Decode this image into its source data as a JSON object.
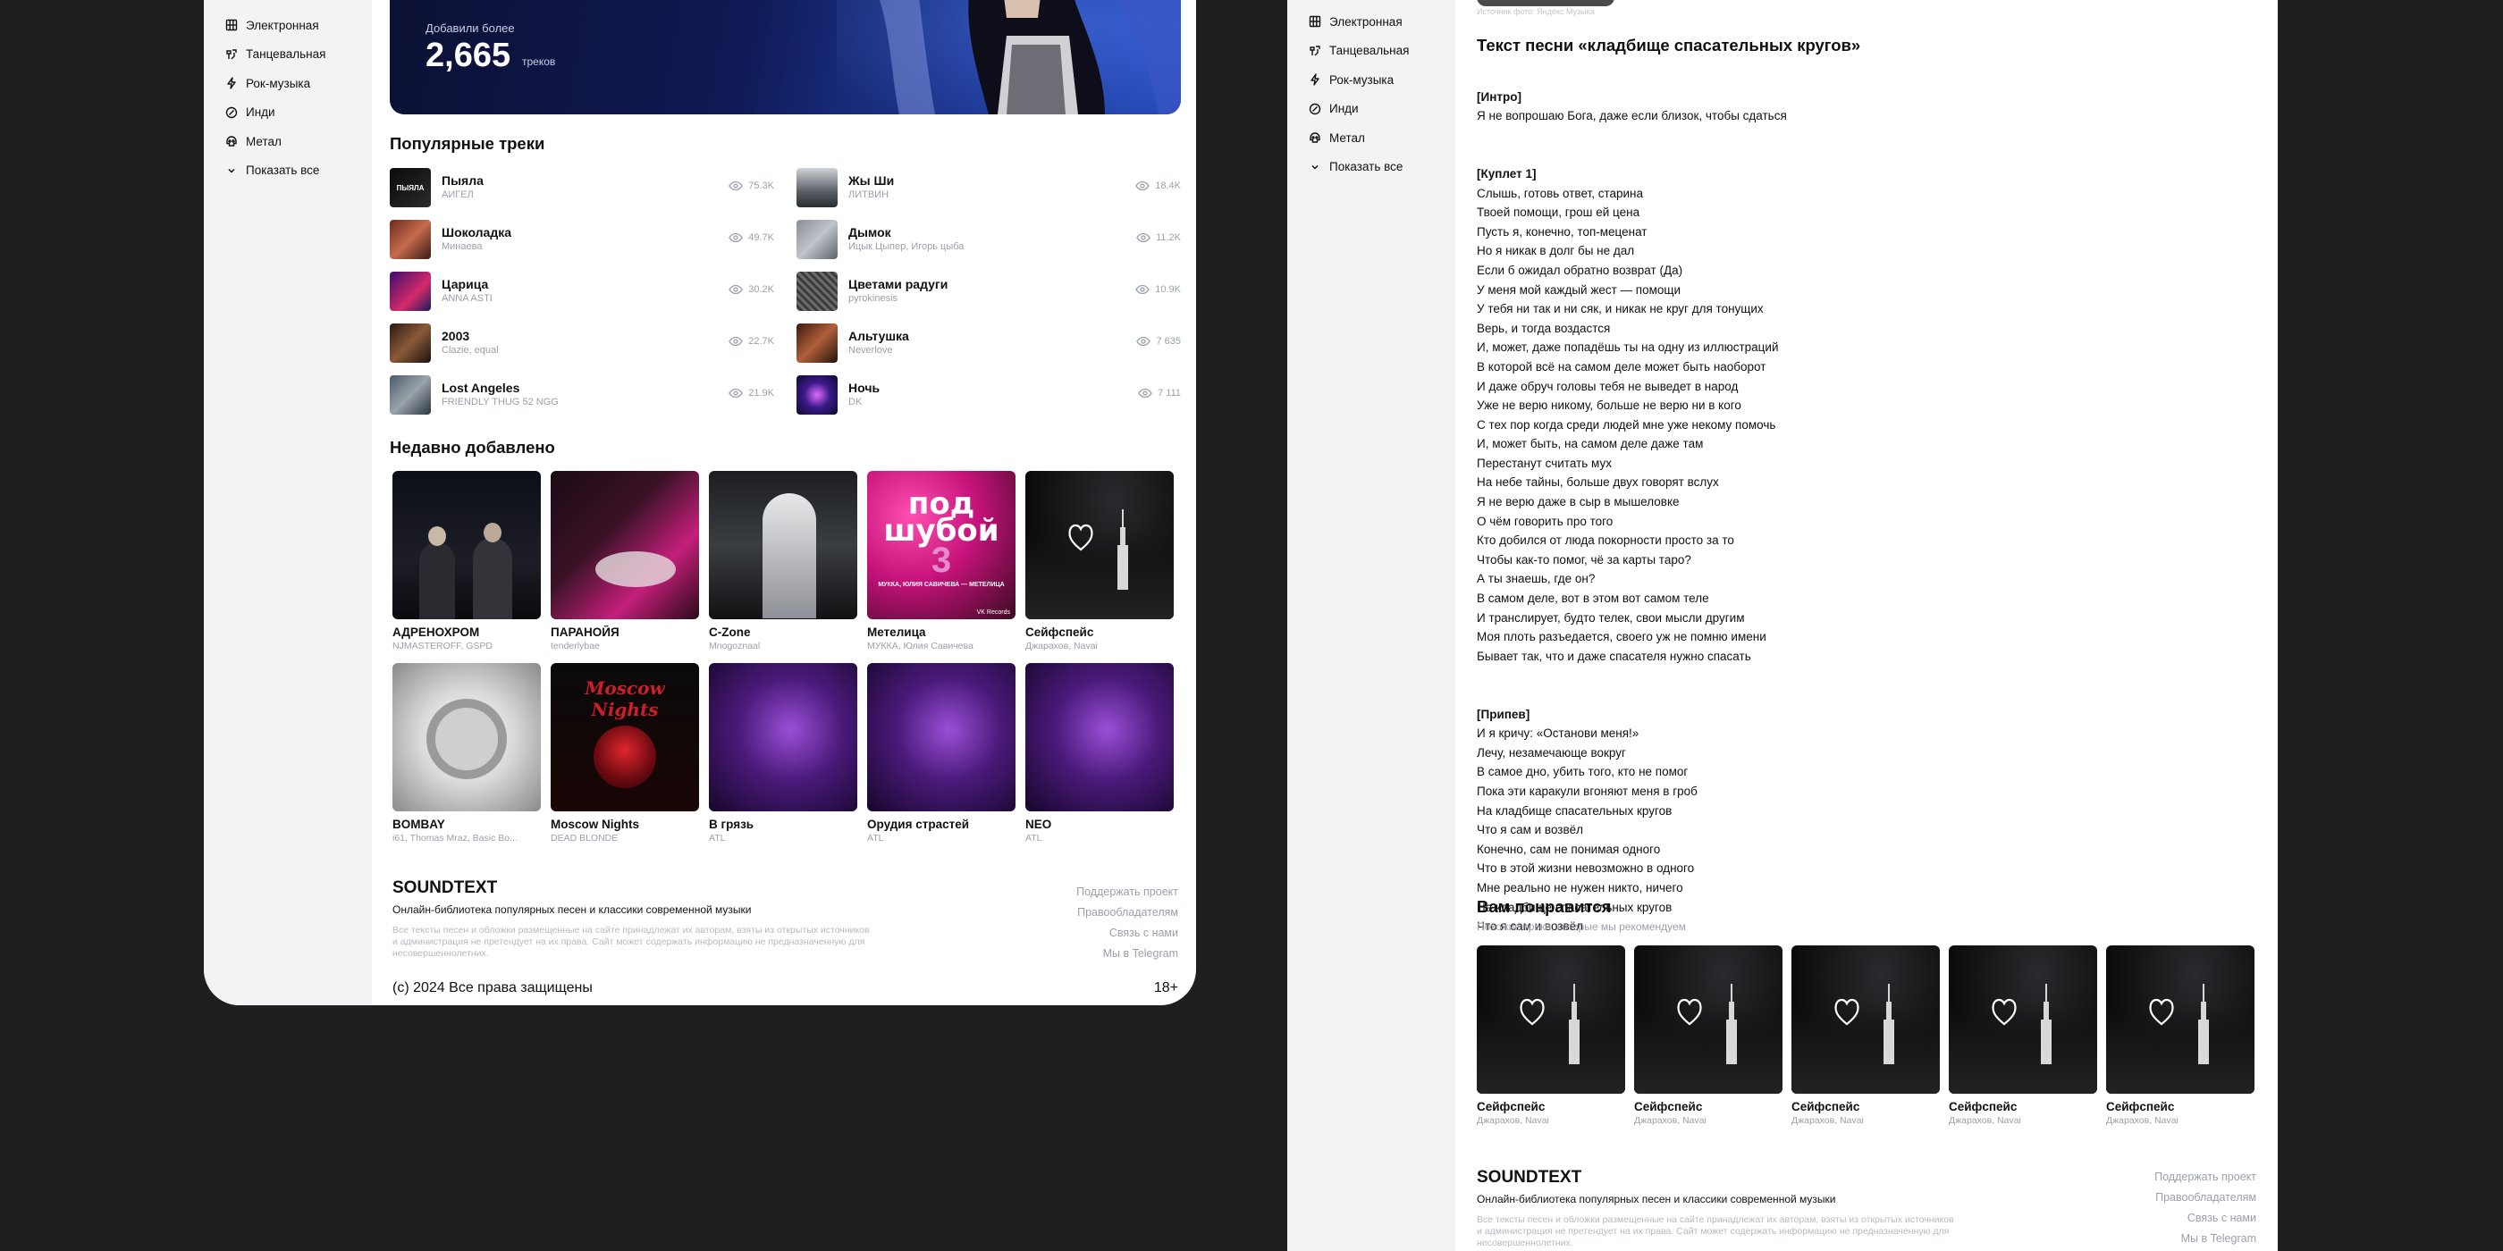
{
  "colors": {
    "page_bg": "#1f1f1f",
    "sidebar_bg": "#f2f3f5",
    "muted_text": "#9aa0ab",
    "hero_blue": "#2d5be0"
  },
  "sidebar": {
    "items": [
      {
        "label": "Электронная",
        "icon": "grid-icon"
      },
      {
        "label": "Танцевальная",
        "icon": "dance-icon"
      },
      {
        "label": "Рок-музыка",
        "icon": "lightning-icon"
      },
      {
        "label": "Инди",
        "icon": "disc-icon"
      },
      {
        "label": "Метал",
        "icon": "skull-icon"
      }
    ],
    "show_all": "Показать все"
  },
  "hero": {
    "added_label": "Добавили более",
    "count": "2,665",
    "unit": "треков"
  },
  "popular": {
    "title": "Популярные треки",
    "left": [
      {
        "name": "Пыяла",
        "artist": "АИГЕЛ",
        "views": "75.3K"
      },
      {
        "name": "Шоколадка",
        "artist": "Минаева",
        "views": "49.7K"
      },
      {
        "name": "Царица",
        "artist": "ANNA ASTI",
        "views": "30.2K"
      },
      {
        "name": "2003",
        "artist": "Clazie, equal",
        "views": "22.7K"
      },
      {
        "name": "Lost Angeles",
        "artist": "FRIENDLY THUG 52 NGG",
        "views": "21.9K"
      }
    ],
    "right": [
      {
        "name": "Жы Ши",
        "artist": "ЛИТВИН",
        "views": "18.4K"
      },
      {
        "name": "Дымок",
        "artist": "Ицык Цыпер, Игорь цыба",
        "views": "11.2K"
      },
      {
        "name": "Цветами радуги",
        "artist": "pyrokinesis",
        "views": "10.9K"
      },
      {
        "name": "Альтушка",
        "artist": "Neverlove",
        "views": "7 635"
      },
      {
        "name": "Ночь",
        "artist": "DK",
        "views": "7 111"
      }
    ]
  },
  "recent": {
    "title": "Недавно добавлено",
    "row1": [
      {
        "title": "АДРЕНОХРОМ",
        "artist": "NJMASTEROFF, GSPD"
      },
      {
        "title": "ПАРАНОЙЯ",
        "artist": "tenderlybae"
      },
      {
        "title": "C-Zone",
        "artist": "Mnogoznaal"
      },
      {
        "title": "Метелица",
        "artist": "МУККА, Юлия Савичева"
      },
      {
        "title": "Сейфспейс",
        "artist": "Джарахов, Navai"
      }
    ],
    "row2": [
      {
        "title": "BOMBAY",
        "artist": "i61, Thomas Mraz, Basic Bo..."
      },
      {
        "title": "Moscow Nights",
        "artist": "DEAD BLONDE"
      },
      {
        "title": "В грязь",
        "artist": "ATL"
      },
      {
        "title": "Орудия страстей",
        "artist": "ATL"
      },
      {
        "title": "NEO",
        "artist": "ATL"
      }
    ],
    "cover_text": {
      "big": "под шубой",
      "number": "3",
      "small": "МУККА, ЮЛИЯ САВИЧЕВА — МЕТЕЛИЦА",
      "label": "VK Records",
      "moscow": "Moscow Nights"
    }
  },
  "footer": {
    "brand": "SOUNDTEXT",
    "tagline": "Онлайн-библиотека популярных песен и классики современной музыки",
    "legal": "Все тексты песен и обложки размещенные на сайте принадлежат их авторам, взяты из открытых источников и администрация не претендует на их права. Сайт может содержать информацию не предназначенную для несовершеннолетних.",
    "copyright": "(c) 2024 Все права защищены",
    "age": "18+",
    "links": [
      "Поддержать проект",
      "Правообладателям",
      "Связь с нами",
      "Мы в Telegram"
    ]
  },
  "lyrics_page": {
    "image_caption": "Источник фото: Яндекс Музыка",
    "title": "Текст песни «кладбище спасательных кругов»",
    "sections": [
      {
        "header": "[Интро]",
        "lines": "Я не вопрошаю Бога, даже если близок, чтобы сдаться"
      },
      {
        "header": "[Куплет 1]",
        "lines": "Слышь, готовь ответ, старина\nТвоей помощи, грош ей цена\nПусть я, конечно, топ-меценат\nНо я никак в долг бы не дал\nЕсли б ожидал обратно возврат (Да)\nУ меня мой каждый жест — помощи\nУ тебя ни так и ни сяк, и никак не круг для тонущих\nВерь, и тогда воздастся\nИ, может, даже попадёшь ты на одну из иллюстраций\nВ которой всё на самом деле может быть наоборот\nИ даже обруч головы тебя не выведет в народ\nУже не верю никому, больше не верю ни в кого\nС тех пор когда среди людей мне уже некому помочь\nИ, может быть, на самом деле даже там\nПерестанут считать мух\nНа небе тайны, больше двух говорят вслух\nЯ не верю даже в сыр в мышеловке\nО чём говорить про того\nКто добился от люда покорности просто за то\nЧтобы как-то помог, чё за карты таро?\nА ты знаешь, где он?\nВ самом деле, вот в этом вот самом теле\nИ транслирует, будто телек, свои мысли другим\nМоя плоть разъедается, своего уж не помню имени\nБывает так, что и даже спасателя нужно спасать"
      },
      {
        "header": "[Припев]",
        "lines": "И я кричу: «Останови меня!»\nЛечу, незамечающе вокруг\nВ самое дно, убить того, кто не помог\nПока эти каракули вгоняют меня в гроб\nНа кладбище спасательных кругов\nЧто я сам и возвёл\nКонечно, сам не понимая одного\nЧто в этой жизни невозможно в одного\nМне реально не нужен никто, ничего\nНа кладбище спасательных кругов\nЧто я сам и возвёл"
      }
    ],
    "recommend_title": "Вам понравится",
    "recommend_sub": "Похожие треки, которые мы рекомендуем",
    "recommend": [
      {
        "title": "Сейфспейс",
        "artist": "Джарахов, Navai"
      },
      {
        "title": "Сейфспейс",
        "artist": "Джарахов, Navai"
      },
      {
        "title": "Сейфспейс",
        "artist": "Джарахов, Navai"
      },
      {
        "title": "Сейфспейс",
        "artist": "Джарахов, Navai"
      },
      {
        "title": "Сейфспейс",
        "artist": "Джарахов, Navai"
      }
    ]
  }
}
